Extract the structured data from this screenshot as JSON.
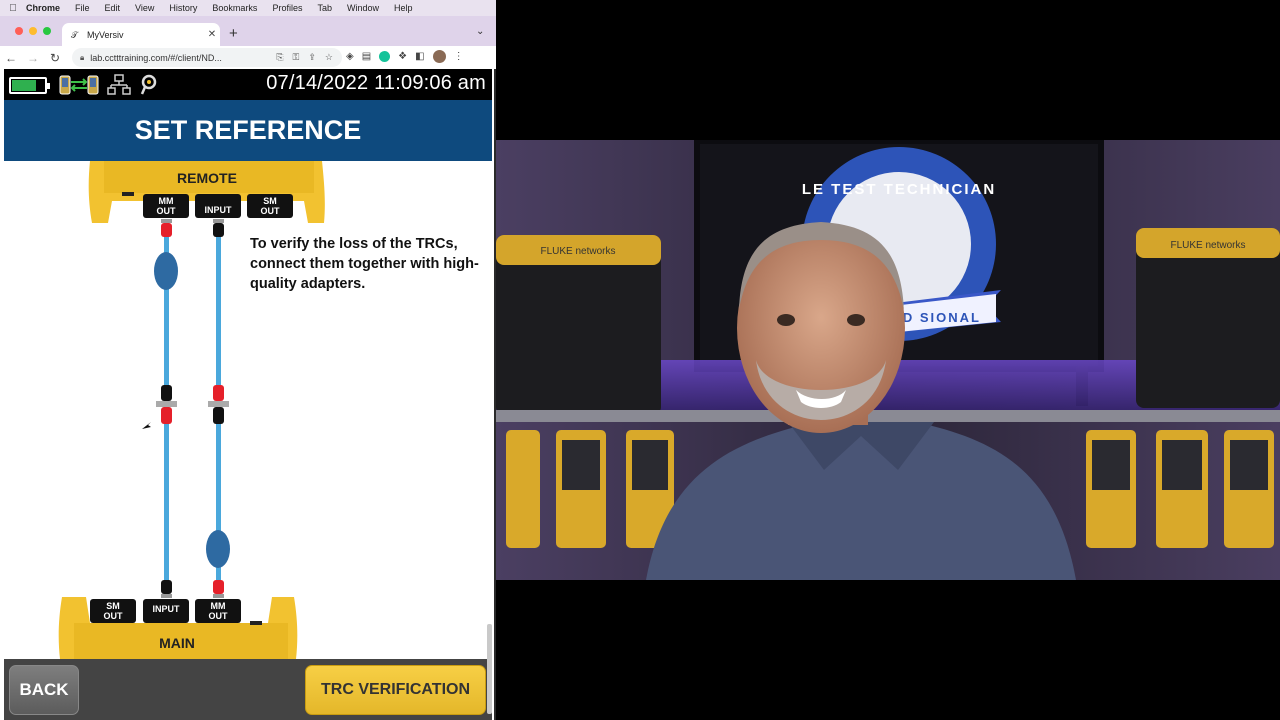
{
  "menubar": {
    "items": [
      "Chrome",
      "File",
      "Edit",
      "View",
      "History",
      "Bookmarks",
      "Profiles",
      "Tab",
      "Window",
      "Help"
    ]
  },
  "browser": {
    "tab_title": "MyVersiv",
    "url": "lab.cctttraining.com/#/client/ND..."
  },
  "device": {
    "datetime": "07/14/2022 11:09:06 am",
    "battery_level": 0.75,
    "screen_title": "SET REFERENCE",
    "remote_label": "REMOTE",
    "main_label": "MAIN",
    "remote_ports": [
      "MM OUT",
      "INPUT",
      "SM OUT"
    ],
    "main_ports": [
      "SM OUT",
      "INPUT",
      "MM OUT"
    ],
    "instruction": "To verify the loss of the TRCs, connect them together with high-quality adapters.",
    "back_label": "BACK",
    "trc_label": "TRC VERIFICATION"
  },
  "webcam": {
    "banner_words": "LE TEST TECHNICIAN",
    "banner_bottom": "IFIED SIONAL",
    "brand_left": "FLUKE networks",
    "brand_right": "FLUKE networks"
  },
  "colors": {
    "title_bar": "#0e4a7e",
    "unit_yellow": "#f0c030",
    "cable_blue": "#4aa8dc",
    "connector_red": "#e5202a",
    "trc_button": "#f0c43a"
  }
}
